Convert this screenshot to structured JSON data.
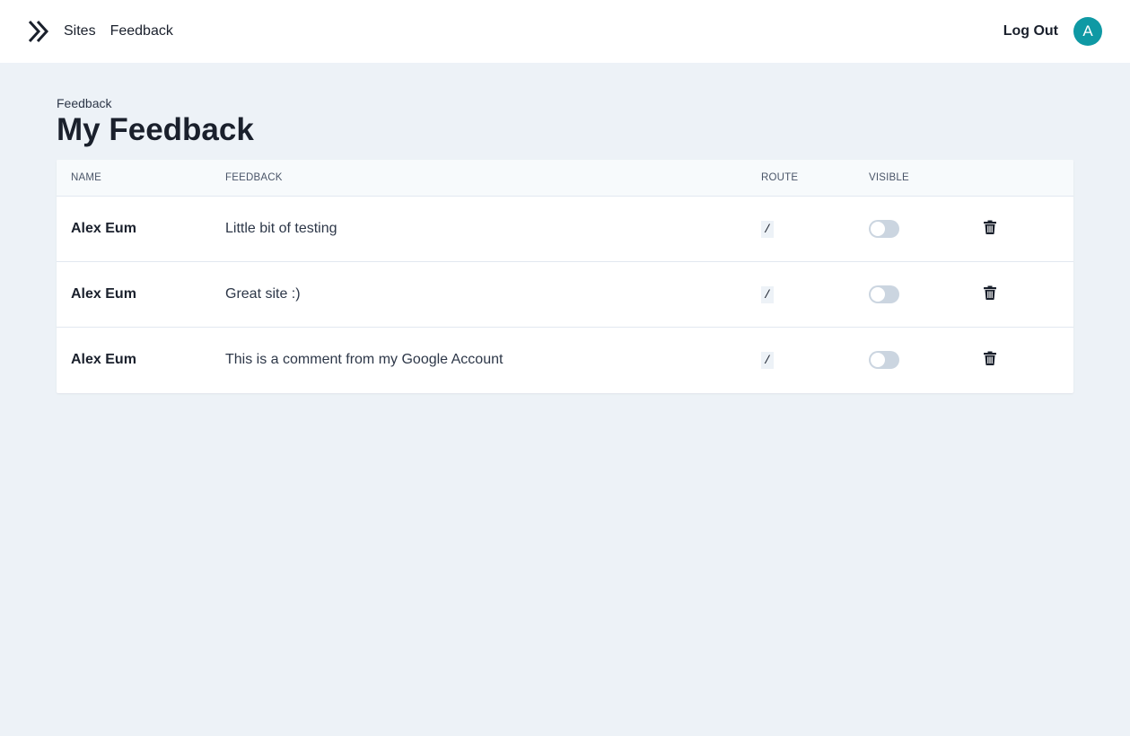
{
  "nav": {
    "links": [
      {
        "label": "Sites"
      },
      {
        "label": "Feedback"
      }
    ],
    "logout_label": "Log Out",
    "avatar_initial": "A"
  },
  "page": {
    "breadcrumb": "Feedback",
    "title": "My Feedback"
  },
  "table": {
    "headers": [
      "NAME",
      "FEEDBACK",
      "ROUTE",
      "VISIBLE",
      ""
    ],
    "rows": [
      {
        "name": "Alex Eum",
        "feedback": "Little bit of testing",
        "route": "/",
        "visible": false
      },
      {
        "name": "Alex Eum",
        "feedback": "Great site :)",
        "route": "/",
        "visible": false
      },
      {
        "name": "Alex Eum",
        "feedback": "This is a comment from my Google Account",
        "route": "/",
        "visible": false
      }
    ]
  },
  "colors": {
    "accent": "#0f99a4",
    "background": "#edf2f7",
    "toggle_off": "#cbd5e0"
  },
  "icons": {
    "logo": "double-chevron-right-icon",
    "delete": "trash-icon"
  }
}
